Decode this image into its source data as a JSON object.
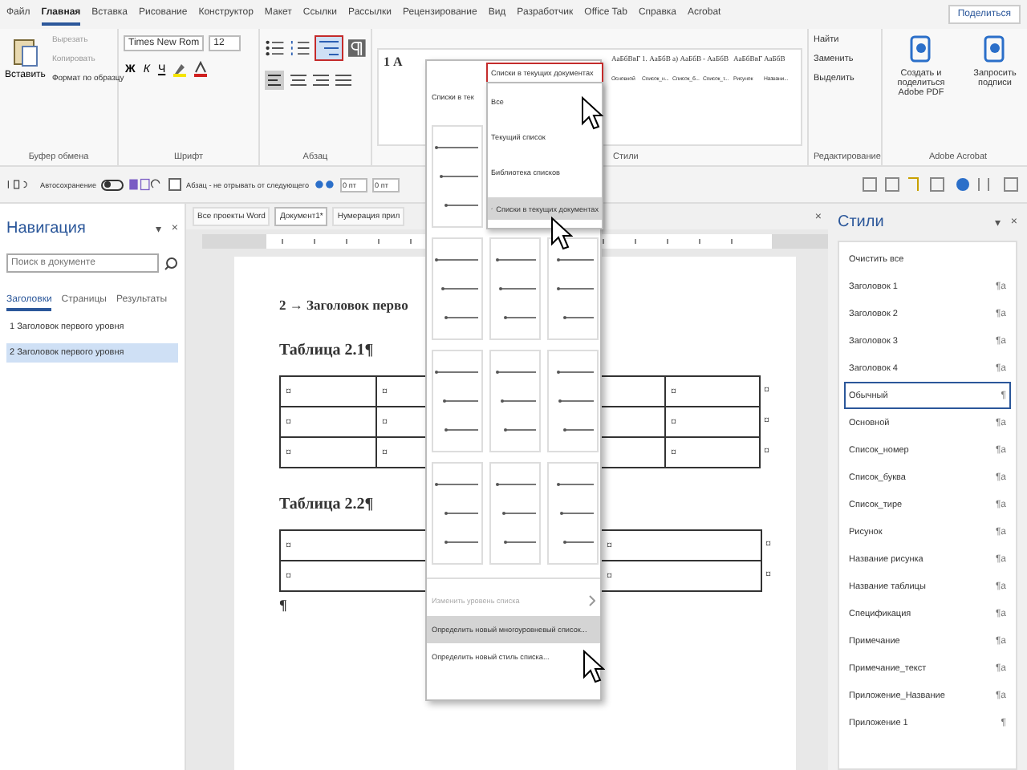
{
  "menu_tabs": [
    {
      "label": "Файл",
      "selected": false
    },
    {
      "label": "Главная",
      "selected": true
    },
    {
      "label": "Вставка",
      "selected": false
    },
    {
      "label": "Рисование",
      "selected": false
    },
    {
      "label": "Конструктор",
      "selected": false
    },
    {
      "label": "Макет",
      "selected": false
    },
    {
      "label": "Ссылки",
      "selected": false
    },
    {
      "label": "Рассылки",
      "selected": false
    },
    {
      "label": "Рецензирование",
      "selected": false
    },
    {
      "label": "Вид",
      "selected": false
    },
    {
      "label": "Разработчик",
      "selected": false
    },
    {
      "label": "Office Tab",
      "selected": false
    },
    {
      "label": "Справка",
      "selected": false
    },
    {
      "label": "Acrobat",
      "selected": false
    }
  ],
  "share_button": "Поделиться",
  "ribbon": {
    "clipboard": {
      "paste": "Вставить",
      "cut": "Вырезать",
      "copy": "Копировать",
      "format_painter": "Формат по образцу",
      "label": "Буфер обмена"
    },
    "font": {
      "name": "Times New Rom",
      "size": "12",
      "format_buttons": [
        "Ж",
        "К",
        "Ч"
      ],
      "label": "Шрифт"
    },
    "paragraph": {
      "label": "Абзац",
      "multilevel_list_active": true
    },
    "styles": {
      "visible_preview": "1 А",
      "label": "Стили",
      "items": [
        {
          "preview": "АаБбВвГ",
          "name": "Основной"
        },
        {
          "preview": "1. АаБбВ",
          "name": "Список_н..."
        },
        {
          "preview": "а) АаБбВ",
          "name": "Список_б..."
        },
        {
          "preview": "- АаБбВ",
          "name": "Список_т..."
        },
        {
          "preview": "АаБбВвГ",
          "name": "Рисунок"
        },
        {
          "preview": "АаБбВ",
          "name": "Названи..."
        }
      ]
    },
    "editing": {
      "label": "Редактирование",
      "items": [
        "Найти",
        "Заменить",
        "Выделить"
      ]
    },
    "acrobat": {
      "label": "Adobe Acrobat",
      "items": [
        "Создать и поделиться Adobe PDF",
        "Запросить подписи"
      ]
    }
  },
  "quick_toolbar": {
    "autosave": "Автосохранение",
    "autosave_on": false,
    "keep_with_next": {
      "label": "Абзац - не отрывать от следующего",
      "checked": false
    },
    "spacing_before": "0 пт",
    "spacing_after": "0 пт"
  },
  "navigation": {
    "title": "Навигация",
    "options_button": "▾",
    "close_button": "×",
    "search": {
      "placeholder": "Поиск в документе"
    },
    "tabs": [
      {
        "label": "Заголовки",
        "selected": true
      },
      {
        "label": "Страницы",
        "selected": false
      },
      {
        "label": "Результаты",
        "selected": false
      }
    ],
    "items": [
      {
        "label": "1 Заголовок первого уровня",
        "selected": false
      },
      {
        "label": "2 Заголовок первого уровня",
        "selected": true
      }
    ]
  },
  "document_tabs": [
    {
      "label": "Все проекты Word",
      "selected": false
    },
    {
      "label": "Документ1*",
      "selected": true
    },
    {
      "label": "Нумерация прил",
      "selected": false
    }
  ],
  "document_tabs_close": "×",
  "document": {
    "heading": "2 → Заголовок перво",
    "table_1": {
      "caption": "Таблица 2.1¶",
      "rows": [
        [
          "¤",
          "¤",
          "¤"
        ],
        [
          "¤",
          "¤",
          "¤"
        ],
        [
          "¤",
          "¤",
          "¤"
        ]
      ],
      "row_end": "¤"
    },
    "table_2": {
      "caption": "Таблица 2.2¶",
      "rows": [
        [
          "¤",
          "¤"
        ],
        [
          "¤",
          "¤"
        ]
      ],
      "row_end": "¤"
    },
    "end_mark": "¶"
  },
  "styles_pane": {
    "title": "Стили",
    "options_button": "▾",
    "close_button": "×",
    "items": [
      {
        "name": "Очистить все",
        "selected": false
      },
      {
        "name": "Заголовок 1",
        "mark": "¶a",
        "selected": false
      },
      {
        "name": "Заголовок 2",
        "mark": "¶a",
        "selected": false
      },
      {
        "name": "Заголовок 3",
        "mark": "¶a",
        "selected": false
      },
      {
        "name": "Заголовок 4",
        "mark": "¶a",
        "selected": false
      },
      {
        "name": "Обычный",
        "mark": "¶",
        "selected": true
      },
      {
        "name": "Основной",
        "mark": "¶a",
        "selected": false
      },
      {
        "name": "Список_номер",
        "mark": "¶a",
        "selected": false
      },
      {
        "name": "Список_буква",
        "mark": "¶a",
        "selected": false
      },
      {
        "name": "Список_тире",
        "mark": "¶a",
        "selected": false
      },
      {
        "name": "Рисунок",
        "mark": "¶a",
        "selected": false
      },
      {
        "name": "Название рисунка",
        "mark": "¶a",
        "selected": false
      },
      {
        "name": "Название таблицы",
        "mark": "¶a",
        "selected": false
      },
      {
        "name": "Спецификация",
        "mark": "¶a",
        "selected": false
      },
      {
        "name": "Примечание",
        "mark": "¶a",
        "selected": false
      },
      {
        "name": "Примечание_текст",
        "mark": "¶a",
        "selected": false
      },
      {
        "name": "Приложение_Название",
        "mark": "¶a",
        "selected": false
      },
      {
        "name": "Приложение 1",
        "mark": "¶",
        "selected": false
      }
    ]
  },
  "list_dropdown": {
    "header": "Списки в тек",
    "filter": "Списки в текущих документах",
    "filter_options": [
      {
        "label": "Все",
        "selected": false
      },
      {
        "label": "Текущий список",
        "selected": false
      },
      {
        "label": "Библиотека списков",
        "selected": false
      },
      {
        "label": "Списки в текущих документах",
        "selected": true
      }
    ],
    "commands": [
      {
        "label": "Изменить уровень списка",
        "disabled": true,
        "selected": false,
        "submenu": true
      },
      {
        "label": "Определить новый многоуровневый список...",
        "disabled": false,
        "selected": true,
        "submenu": false
      },
      {
        "label": "Определить новый стиль списка...",
        "disabled": false,
        "selected": false,
        "submenu": false
      }
    ]
  }
}
